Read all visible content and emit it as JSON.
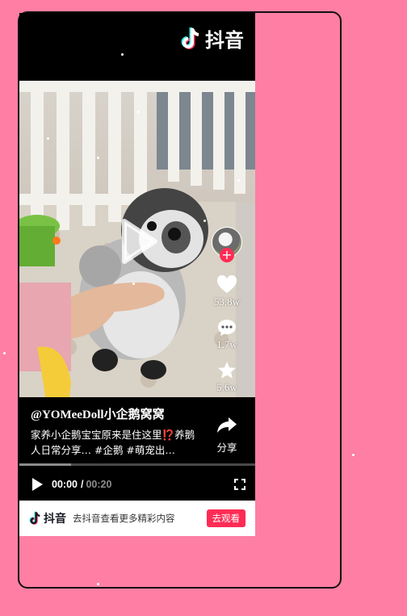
{
  "app": {
    "logo_text": "抖音"
  },
  "video": {
    "author": "@YOMeeDoll小企鹅窝窝",
    "description": "家养小企鹅宝宝原来是住这里⁉️养鹅人日常分享… #企鹅 #萌宠出…"
  },
  "actions": {
    "likes": "53.8w",
    "comments": "1.7w",
    "favorites": "5.6w",
    "share_label": "分享"
  },
  "player": {
    "current_time": "00:00",
    "separator": "/",
    "duration": "00:20",
    "progress": 0.22
  },
  "banner": {
    "brand": "抖音",
    "text": "去抖音查看更多精彩内容",
    "button": "去观看"
  },
  "colors": {
    "page_background": "#ff7ea4",
    "accent": "#fe2c55"
  },
  "icons": [
    "douyin-logo-icon",
    "play-icon",
    "follow-plus-icon",
    "heart-icon",
    "comment-icon",
    "star-icon",
    "share-icon",
    "fullscreen-icon"
  ]
}
